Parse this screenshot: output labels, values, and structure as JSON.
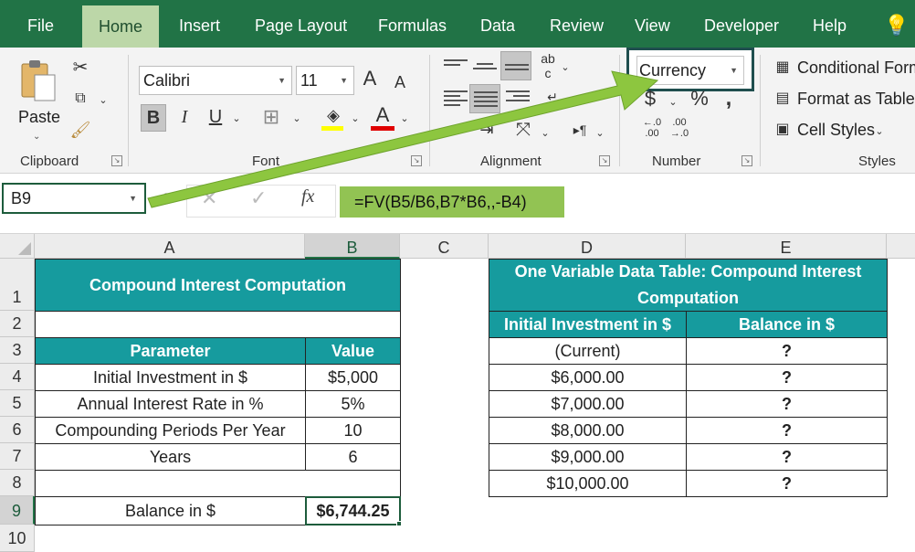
{
  "tabs": [
    "File",
    "Home",
    "Insert",
    "Page Layout",
    "Formulas",
    "Data",
    "Review",
    "View",
    "Developer",
    "Help"
  ],
  "ribbon": {
    "paste_label": "Paste",
    "groups": {
      "clipboard": "Clipboard",
      "font": "Font",
      "alignment": "Alignment",
      "number": "Number",
      "styles": "Styles"
    },
    "font_name": "Calibri",
    "font_size": "11",
    "number_format": "Currency",
    "conditional_formatting": "Conditional Form",
    "format_as_table": "Format as Table",
    "cell_styles": "Cell Styles"
  },
  "formula_bar": {
    "name_box": "B9",
    "formula": "=FV(B5/B6,B7*B6,,-B4)"
  },
  "columns": [
    "A",
    "B",
    "C",
    "D",
    "E"
  ],
  "rows": [
    "1",
    "2",
    "3",
    "4",
    "5",
    "6",
    "7",
    "8",
    "9",
    "10"
  ],
  "table1": {
    "title": "Compound Interest Computation",
    "header": [
      "Parameter",
      "Value"
    ],
    "rows": [
      [
        "Initial Investment in $",
        "$5,000"
      ],
      [
        "Annual Interest Rate in %",
        "5%"
      ],
      [
        "Compounding Periods Per Year",
        "10"
      ],
      [
        "Years",
        "6"
      ]
    ],
    "result_label": "Balance in $",
    "result_value": "$6,744.25"
  },
  "table2": {
    "title_line1": "One Variable Data Table: Compound Interest",
    "title_line2": "Computation",
    "header": [
      "Initial Investment in $",
      "Balance in $"
    ],
    "rows": [
      [
        "(Current)",
        "?"
      ],
      [
        "$6,000.00",
        "?"
      ],
      [
        "$7,000.00",
        "?"
      ],
      [
        "$8,000.00",
        "?"
      ],
      [
        "$9,000.00",
        "?"
      ],
      [
        "$10,000.00",
        "?"
      ]
    ]
  },
  "colors": {
    "ribbon_green": "#217346",
    "table_header": "#169b9e",
    "arrow": "#8dc63f",
    "formula_highlight": "#92c353"
  }
}
